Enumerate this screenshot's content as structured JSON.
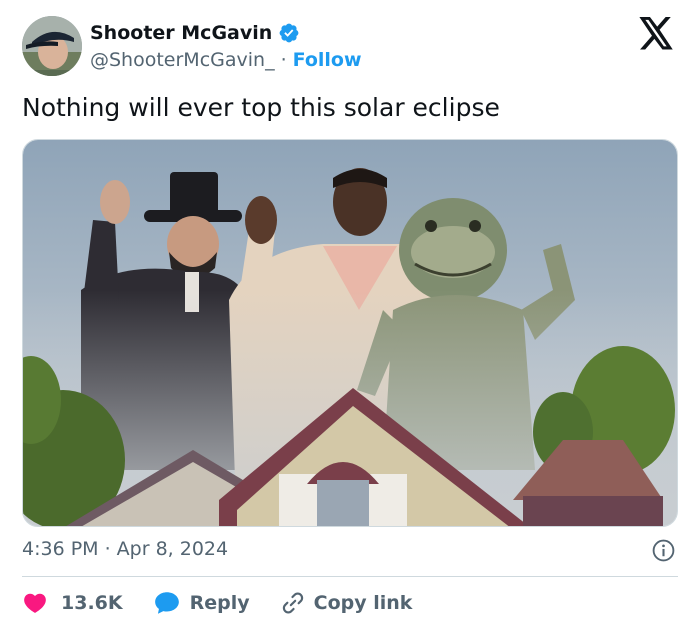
{
  "author": {
    "display_name": "Shooter McGavin",
    "handle": "@ShooterMcGavin_",
    "separator": "·",
    "follow_label": "Follow",
    "verified": true
  },
  "tweet": {
    "text": "Nothing will ever top this solar eclipse",
    "timestamp": "4:36 PM · Apr 8, 2024"
  },
  "actions": {
    "likes_count": "13.6K",
    "reply_label": "Reply",
    "copy_link_label": "Copy link"
  },
  "colors": {
    "link_blue": "#1d9bf0",
    "like_red": "#f91880",
    "secondary_text": "#536471",
    "divider": "#cfd9de"
  },
  "icons": {
    "brand": "x-logo-icon",
    "verified": "verified-badge-icon",
    "info": "info-icon",
    "like": "heart-icon",
    "reply": "speech-bubble-icon",
    "copy": "link-icon"
  }
}
